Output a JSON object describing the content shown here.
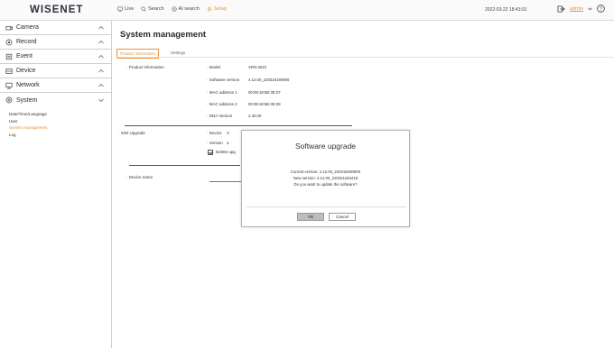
{
  "app": {
    "logo": "WISENET"
  },
  "topbar": {
    "menu": [
      {
        "label": "Live",
        "icon": "monitor-icon",
        "active": false
      },
      {
        "label": "Search",
        "icon": "search-icon",
        "active": false
      },
      {
        "label": "AI search",
        "icon": "ai-search-icon",
        "active": false
      },
      {
        "label": "Setup",
        "icon": "setup-icon",
        "active": true
      }
    ],
    "datetime": "2022-03-22 18:43:01",
    "user": "admin"
  },
  "sidebar": {
    "items": [
      {
        "label": "Camera",
        "icon": "camera-icon"
      },
      {
        "label": "Record",
        "icon": "record-icon"
      },
      {
        "label": "Event",
        "icon": "event-icon"
      },
      {
        "label": "Device",
        "icon": "device-icon"
      },
      {
        "label": "Network",
        "icon": "network-icon"
      },
      {
        "label": "System",
        "icon": "system-icon",
        "expanded": true
      }
    ],
    "system_sub": [
      {
        "label": "Date/Time/Language",
        "active": false
      },
      {
        "label": "User",
        "active": false
      },
      {
        "label": "System management",
        "active": true
      },
      {
        "label": "Log",
        "active": false
      }
    ]
  },
  "main": {
    "title": "System management",
    "tabs": [
      {
        "label": "Product information",
        "active": true
      },
      {
        "label": "Settings",
        "active": false
      }
    ],
    "product_info": {
      "section_label": "Product information",
      "rows": [
        {
          "label": "Model",
          "value": "XRN-3010"
        },
        {
          "label": "Software version",
          "value": "4.12.00_220318190906"
        },
        {
          "label": "MAC address 1",
          "value": "00:09:18:5B:3E:07"
        },
        {
          "label": "MAC address 2",
          "value": "00:09:18:5B:3E:08"
        },
        {
          "label": "DNA Version",
          "value": "2.40.00"
        }
      ]
    },
    "sw_upgrade": {
      "section_label": "S/W Upgrade",
      "device_label": "Device",
      "device_value": "X",
      "version_label": "Version",
      "version_value": "4.",
      "delete_label": "Delete upg"
    },
    "device_name": {
      "label": "Device name"
    }
  },
  "dialog": {
    "title": "Software upgrade",
    "current": "Current version: 4.12.00_220318190906",
    "new": "New version: 4.12.00_220321163418",
    "question": "Do you want to update the software?",
    "ok": "Ok",
    "cancel": "Cancel"
  },
  "colors": {
    "accent": "#e8913a",
    "text": "#333333",
    "border": "#cfcfcf"
  }
}
